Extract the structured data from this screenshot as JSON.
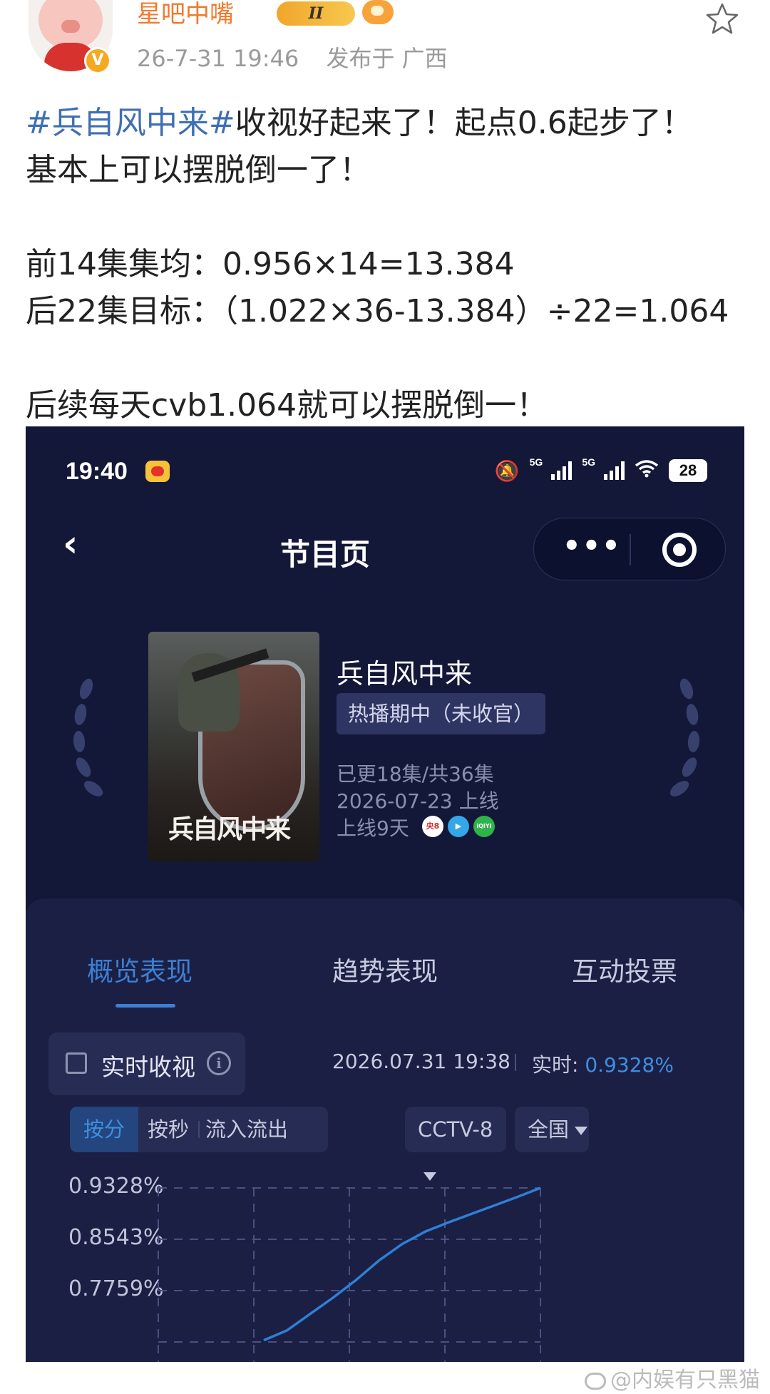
{
  "post": {
    "username": "星吧中嘴",
    "level_badge": "II",
    "datetime": "26-7-31 19:46",
    "location": "发布于 广西",
    "lines": [
      {
        "topic": "#兵自风中来#",
        "text": "收视好起来了！起点0.6起步了！"
      },
      {
        "topic": "",
        "text": "基本上可以摆脱倒一了！"
      },
      {
        "topic": "",
        "text": ""
      },
      {
        "topic": "",
        "text": "前14集集均：0.956×14=13.384"
      },
      {
        "topic": "",
        "text": "后22集目标：（1.022×36-13.384）÷22=1.064"
      },
      {
        "topic": "",
        "text": ""
      },
      {
        "topic": "",
        "text": "后续每天cvb1.064就可以摆脱倒一！"
      }
    ]
  },
  "screenshot": {
    "status_time": "19:40",
    "signal_labels": [
      "5G",
      "5G"
    ],
    "battery": "28",
    "page_title": "节目页",
    "capsule_dots": "•••",
    "show": {
      "poster_title": "兵自风中来",
      "name": "兵自风中来",
      "status": "热播期中（未收官）",
      "episodes": "已更18集/共36集",
      "release": "2026-07-23 上线",
      "days": "上线9天",
      "platforms": [
        "央8",
        "▶",
        "iQIYI"
      ]
    },
    "tabs": [
      "概览表现",
      "趋势表现",
      "互动投票"
    ],
    "active_tab": 0,
    "realtime_label": "实时收视",
    "timestamp": "2026.07.31 19:38",
    "realtime_prefix": "实时:",
    "realtime_value": "0.9328%",
    "segments": [
      "按分",
      "按秒",
      "流入流出"
    ],
    "channel": "CCTV-8",
    "region": "全国"
  },
  "chart_data": {
    "type": "line",
    "y_ticks": [
      "0.9328%",
      "0.8543%",
      "0.7759%"
    ],
    "ylim": [
      0.6974,
      0.9328
    ],
    "x": [
      0,
      1,
      2,
      3,
      4,
      5,
      6,
      7,
      8,
      9,
      10,
      11,
      12
    ],
    "series": [
      {
        "values": [
          0.7,
          0.715,
          0.74,
          0.765,
          0.792,
          0.822,
          0.847,
          0.866,
          0.88,
          0.893,
          0.906,
          0.919,
          0.9328
        ]
      }
    ],
    "grid": true,
    "colors": {
      "line": "#2f7fd6",
      "grid": "#4a5080"
    }
  },
  "watermark": "@内娱有只黑猫"
}
